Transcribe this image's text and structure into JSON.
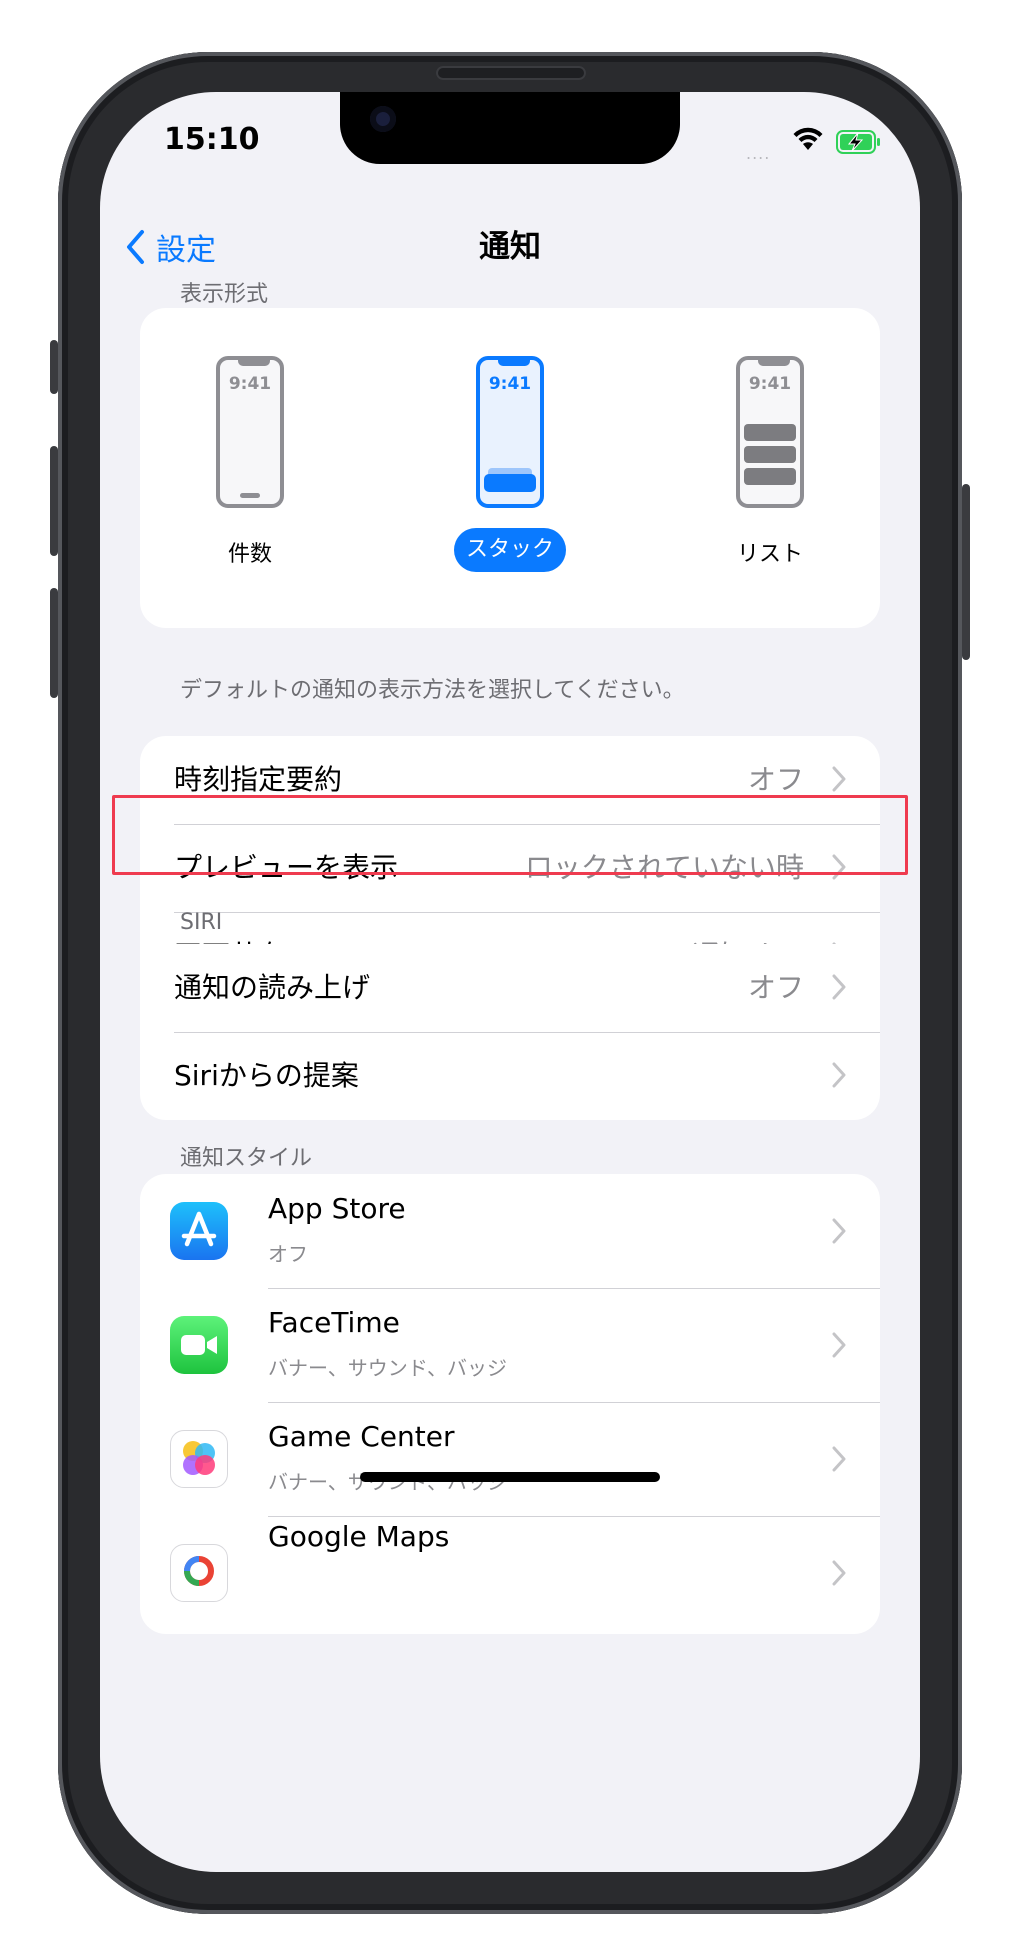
{
  "status_bar": {
    "time": "15:10",
    "signal": "....",
    "battery_color": "#30d158"
  },
  "nav": {
    "back_label": "設定",
    "title": "通知"
  },
  "display_style": {
    "header": "表示形式",
    "options": [
      {
        "label": "件数",
        "time": "9:41",
        "selected": false
      },
      {
        "label": "スタック",
        "time": "9:41",
        "selected": true
      },
      {
        "label": "リスト",
        "time": "9:41",
        "selected": false
      }
    ],
    "footnote": "デフォルトの通知の表示方法を選択してください。"
  },
  "general_rows": [
    {
      "label": "時刻指定要約",
      "value": "オフ"
    },
    {
      "label": "プレビューを表示",
      "value": "ロックされていない時"
    },
    {
      "label": "画面共有",
      "value": "通知オフ"
    }
  ],
  "siri": {
    "header": "SIRI",
    "rows": [
      {
        "label": "通知の読み上げ",
        "value": "オフ"
      },
      {
        "label": "Siriからの提案",
        "value": ""
      }
    ]
  },
  "notification_style": {
    "header": "通知スタイル",
    "apps": [
      {
        "name": "App Store",
        "sub": "オフ",
        "icon": "app-store-icon"
      },
      {
        "name": "FaceTime",
        "sub": "バナー、サウンド、バッジ",
        "icon": "facetime-icon"
      },
      {
        "name": "Game Center",
        "sub": "バナー、サウンド、バッジ",
        "icon": "game-center-icon"
      },
      {
        "name": "Google Maps",
        "sub": "",
        "icon": "google-maps-icon"
      }
    ]
  },
  "colors": {
    "accent": "#0a7aff",
    "highlight": "#ef3b4f"
  }
}
